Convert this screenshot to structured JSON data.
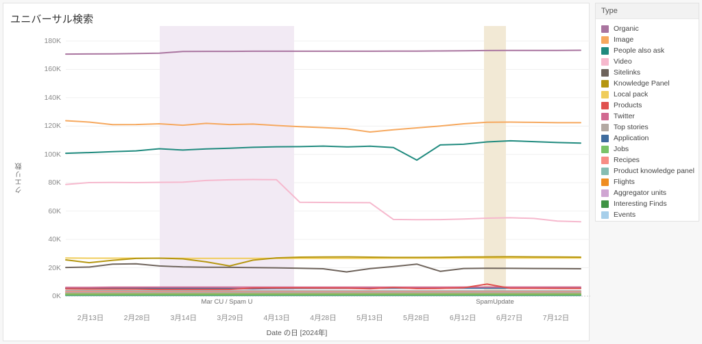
{
  "chart_title": "ユニバーサル検索",
  "legend": {
    "header": "Type"
  },
  "chart_data": {
    "type": "line",
    "title": "ユニバーサル検索",
    "xlabel": "Date の日 [2024年]",
    "ylabel": "クエリ数",
    "ylim": [
      0,
      180000
    ],
    "ytick_labels": [
      "0K",
      "20K",
      "40K",
      "60K",
      "80K",
      "100K",
      "120K",
      "140K",
      "160K",
      "180K"
    ],
    "ytick_values": [
      0,
      20000,
      40000,
      60000,
      80000,
      100000,
      120000,
      140000,
      160000,
      180000
    ],
    "grid": true,
    "legend_position": "right",
    "legend_title": "Type",
    "xtick_labels": [
      "2月13日",
      "2月28日",
      "3月14日",
      "3月29日",
      "4月13日",
      "4月28日",
      "5月13日",
      "5月28日",
      "6月12日",
      "6月27日",
      "7月12日"
    ],
    "x": [
      "2月06日",
      "2月13日",
      "2月20日",
      "2月28日",
      "3月06日",
      "3月14日",
      "3月21日",
      "3月29日",
      "4月06日",
      "4月13日",
      "4月20日",
      "4月28日",
      "5月06日",
      "5月13日",
      "5月21日",
      "5月28日",
      "6月06日",
      "6月12日",
      "6月20日",
      "6月27日",
      "7月05日",
      "7月12日",
      "7月19日"
    ],
    "annotations": [
      {
        "label": "Mar CU / Spam U",
        "x_start": "3月06日",
        "x_end": "4月17日",
        "color": "#f2eaf4"
      },
      {
        "label": "SpamUpdate",
        "x_start": "6月24日",
        "x_end": "6月30日",
        "color": "#f2e9d5"
      }
    ],
    "series": [
      {
        "name": "Organic",
        "color": "#a9749f",
        "values": [
          170800,
          170900,
          171000,
          171200,
          171400,
          172600,
          172700,
          172700,
          172800,
          172800,
          172800,
          172800,
          172800,
          172800,
          172900,
          172900,
          173000,
          173100,
          173300,
          173400,
          173400,
          173400,
          173500
        ]
      },
      {
        "name": "Image",
        "color": "#f6a85e",
        "values": [
          123800,
          122800,
          121000,
          121100,
          121600,
          120600,
          121900,
          121100,
          121400,
          120400,
          119600,
          118900,
          118100,
          115800,
          117400,
          118700,
          120000,
          121600,
          122700,
          122800,
          122600,
          122400,
          122400
        ]
      },
      {
        "name": "People also ask",
        "color": "#1f8a7e",
        "values": [
          100800,
          101300,
          101900,
          102500,
          104000,
          103100,
          103900,
          104400,
          105000,
          105400,
          105500,
          105900,
          105300,
          105800,
          104800,
          96000,
          106700,
          107200,
          108800,
          109600,
          109000,
          108400,
          108000
        ]
      },
      {
        "name": "Video",
        "color": "#f6b8cd",
        "values": [
          78800,
          80100,
          80200,
          80100,
          80300,
          80400,
          81600,
          82100,
          82300,
          82200,
          66200,
          66100,
          66000,
          65900,
          54100,
          53900,
          54000,
          54400,
          55000,
          55300,
          54800,
          53000,
          52500
        ]
      },
      {
        "name": "Sitelinks",
        "color": "#6e635b",
        "values": [
          20200,
          20500,
          22600,
          22800,
          21300,
          20600,
          20400,
          20300,
          20100,
          20000,
          19700,
          19300,
          17100,
          19400,
          20900,
          22600,
          17500,
          19500,
          19700,
          19600,
          19500,
          19400,
          19300
        ]
      },
      {
        "name": "Knowledge Panel",
        "color": "#b5960f",
        "values": [
          25600,
          23600,
          25300,
          26600,
          26800,
          26300,
          24200,
          21300,
          25400,
          27000,
          27500,
          27600,
          27700,
          27500,
          27300,
          27300,
          27400,
          27600,
          27700,
          27800,
          27700,
          27600,
          27500
        ]
      },
      {
        "name": "Local pack",
        "color": "#f0cd5b",
        "values": [
          26900,
          26800,
          26800,
          26800,
          26800,
          26700,
          26700,
          26700,
          26700,
          26700,
          26700,
          26700,
          26700,
          26700,
          26800,
          26800,
          26800,
          26900,
          26900,
          26900,
          26900,
          26900,
          26900
        ]
      },
      {
        "name": "Products",
        "color": "#e0514f",
        "values": [
          5100,
          5000,
          5000,
          4900,
          4800,
          4800,
          4800,
          4800,
          5700,
          5800,
          5800,
          5700,
          5600,
          5200,
          6100,
          5300,
          5400,
          5900,
          8500,
          5500,
          5500,
          5400,
          5400
        ]
      },
      {
        "name": "Twitter",
        "color": "#d16a91",
        "values": [
          6200,
          6200,
          6300,
          6300,
          6300,
          6300,
          6300,
          6300,
          6300,
          6300,
          6300,
          6300,
          6300,
          6300,
          6300,
          6300,
          6300,
          6400,
          6400,
          6400,
          6400,
          6400,
          6400
        ]
      },
      {
        "name": "Top stories",
        "color": "#b3a9a2",
        "values": [
          3900,
          3900,
          3900,
          3800,
          3800,
          3800,
          3800,
          3700,
          3700,
          3700,
          3700,
          3700,
          3700,
          3700,
          3700,
          3700,
          3700,
          3700,
          3700,
          3700,
          3700,
          3700,
          3700
        ]
      },
      {
        "name": "Application",
        "color": "#3f6c9e",
        "values": [
          5600,
          5600,
          5600,
          5600,
          5500,
          5500,
          5400,
          5300,
          5200,
          5400,
          5500,
          5500,
          5500,
          5500,
          5600,
          5600,
          5600,
          5600,
          5600,
          5600,
          5600,
          5600,
          5600
        ]
      },
      {
        "name": "Jobs",
        "color": "#79c368",
        "values": [
          1200,
          1200,
          1200,
          1200,
          1200,
          1200,
          1200,
          1200,
          1200,
          1200,
          1200,
          1200,
          1200,
          1200,
          1200,
          1200,
          1200,
          1200,
          1200,
          1200,
          1200,
          1200,
          1200
        ]
      },
      {
        "name": "Recipes",
        "color": "#f78d85",
        "values": [
          3100,
          3100,
          3100,
          3100,
          3100,
          3100,
          3100,
          3100,
          3100,
          3100,
          3100,
          3100,
          3100,
          3100,
          3100,
          3100,
          3100,
          3100,
          3100,
          3100,
          3100,
          3100,
          3100
        ]
      },
      {
        "name": "Product knowledge panel",
        "color": "#86bdb2",
        "values": [
          2400,
          2400,
          2400,
          2400,
          2400,
          2400,
          2400,
          2400,
          2400,
          2400,
          2400,
          2400,
          2400,
          2400,
          2400,
          2400,
          2400,
          2400,
          2400,
          2400,
          2400,
          2400,
          2400
        ]
      },
      {
        "name": "Flights",
        "color": "#ef8d22",
        "values": [
          2000,
          2000,
          2000,
          2000,
          2000,
          2000,
          2000,
          2000,
          2000,
          2000,
          2000,
          2000,
          2000,
          2000,
          2000,
          2000,
          2000,
          2000,
          2000,
          2000,
          2000,
          2000,
          2000
        ]
      },
      {
        "name": "Aggregator units",
        "color": "#cfa5d2",
        "values": [
          1500,
          1500,
          1500,
          1500,
          1500,
          1500,
          1500,
          1500,
          1500,
          1500,
          1500,
          1500,
          1500,
          1500,
          1500,
          1500,
          1500,
          1500,
          1500,
          1500,
          1500,
          1500,
          1500
        ]
      },
      {
        "name": "Interesting Finds",
        "color": "#3f9344",
        "values": [
          700,
          700,
          700,
          700,
          700,
          700,
          700,
          700,
          700,
          700,
          700,
          700,
          700,
          700,
          700,
          700,
          700,
          700,
          700,
          700,
          700,
          700,
          700
        ]
      },
      {
        "name": "Events",
        "color": "#a7cfea",
        "values": [
          400,
          400,
          400,
          400,
          400,
          400,
          400,
          400,
          400,
          400,
          400,
          400,
          400,
          400,
          400,
          400,
          400,
          400,
          400,
          400,
          400,
          400,
          400
        ]
      }
    ]
  }
}
